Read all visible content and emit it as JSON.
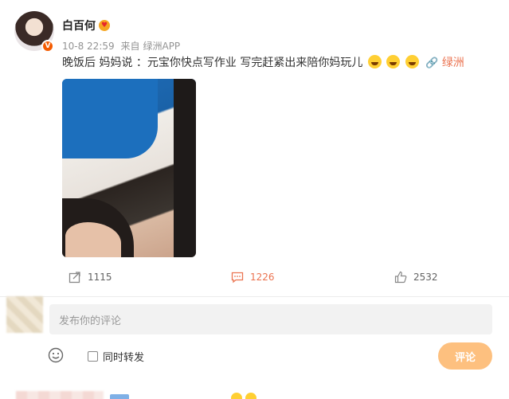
{
  "post": {
    "username": "白百何",
    "date": "10-8 22:59",
    "source_prefix": "来自",
    "source": "绿洲APP",
    "text": "晚饭后 妈妈说 ：元宝你快点写作业 写完赶紧出来陪你妈玩儿",
    "topic": "绿洲",
    "verified_badge": "V"
  },
  "actions": {
    "repost_count": "1115",
    "comment_count": "1226",
    "like_count": "2532"
  },
  "comment_box": {
    "placeholder": "发布你的评论",
    "repost_checkbox_label": "同时转发",
    "submit_label": "评论"
  },
  "colors": {
    "accent": "#eb7350",
    "submit_bg": "#fdc07f",
    "verified": "#f45b00"
  }
}
